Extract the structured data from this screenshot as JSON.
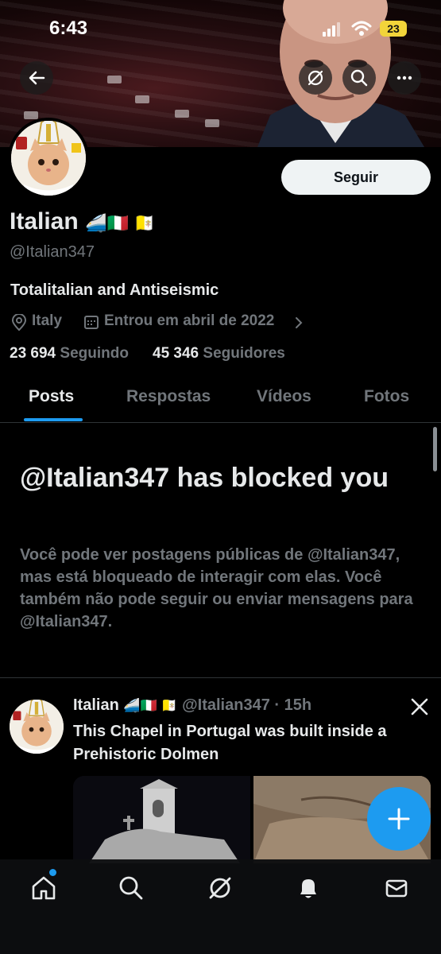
{
  "status_bar": {
    "time": "6:43",
    "battery": "23"
  },
  "profile": {
    "name": "Italian",
    "name_emojis": "🚄🇮🇹 🇻🇦",
    "handle": "@Italian347",
    "bio": "Totalitalian and Antiseismic",
    "location": "Italy",
    "joined": "Entrou em abril de 2022",
    "following_count": "23 694",
    "following_label": "Seguindo",
    "followers_count": "45 346",
    "followers_label": "Seguidores",
    "follow_button": "Seguir"
  },
  "tabs": [
    {
      "label": "Posts",
      "active": true
    },
    {
      "label": "Respostas",
      "active": false
    },
    {
      "label": "Vídeos",
      "active": false
    },
    {
      "label": "Fotos",
      "active": false
    }
  ],
  "blocked": {
    "title": "@Italian347 has blocked you",
    "message": "Você pode ver postagens públicas de @Italian347, mas está bloqueado de interagir com elas. Você também não pode seguir ou enviar mensagens para @Italian347."
  },
  "tweet": {
    "name": "Italian",
    "emojis": "🚄🇮🇹 🇻🇦",
    "handle_time": "@Italian347 · 15h",
    "text": "This Chapel in Portugal was built inside a Prehistoric Dolmen"
  },
  "colors": {
    "accent": "#1d9bf0",
    "background": "#000000",
    "muted": "#71767b"
  },
  "icons": {
    "header": [
      "back-arrow-icon",
      "grok-icon",
      "search-icon",
      "more-icon"
    ],
    "nav": [
      "home-icon",
      "search-icon",
      "grok-icon",
      "notifications-icon",
      "messages-icon"
    ]
  }
}
